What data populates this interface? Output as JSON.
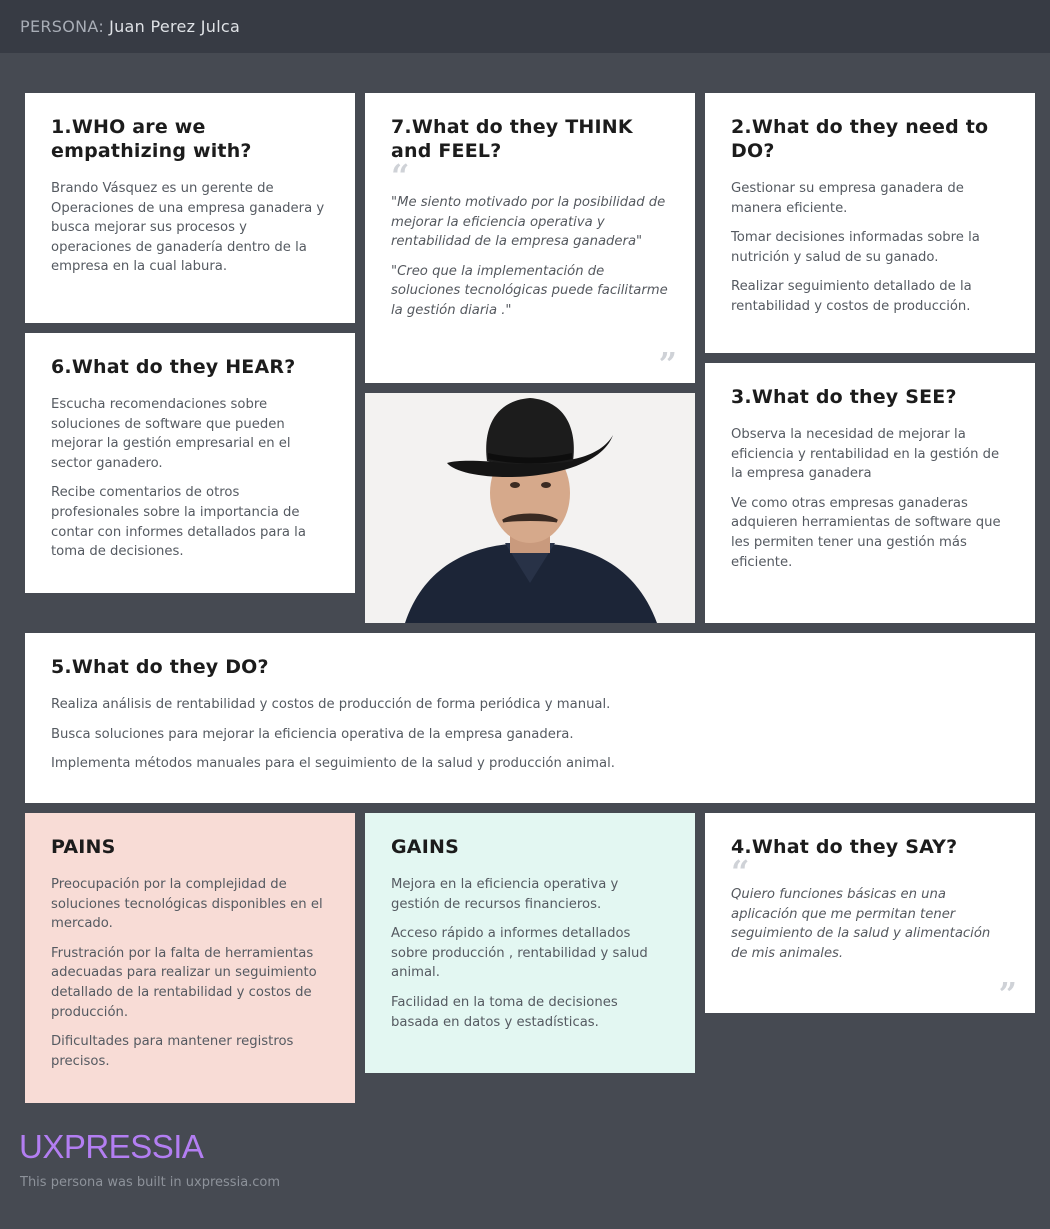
{
  "header": {
    "label": "PERSONA:",
    "name": "Juan Perez Julca"
  },
  "who": {
    "title": "1.WHO are we empathizing with?",
    "items": [
      "Brando Vásquez es un gerente de Operaciones de una empresa ganadera y busca mejorar sus procesos y operaciones de ganadería  dentro de la empresa en la cual labura."
    ]
  },
  "think": {
    "title": "7.What do they THINK and FEEL?",
    "items": [
      "\"Me siento motivado por la posibilidad de mejorar la eficiencia operativa y rentabilidad de la empresa ganadera\"",
      "\"Creo que la implementación de soluciones tecnológicas puede facilitarme la gestión diaria .\""
    ]
  },
  "need": {
    "title": "2.What do they need to DO?",
    "items": [
      "Gestionar su empresa ganadera de manera eficiente.",
      "Tomar decisiones informadas sobre la nutrición y salud de su ganado.",
      "Realizar seguimiento detallado de la rentabilidad y costos de producción."
    ]
  },
  "hear": {
    "title": "6.What do they HEAR?",
    "items": [
      "Escucha recomendaciones sobre soluciones de software que pueden mejorar la gestión empresarial en el sector ganadero.",
      "Recibe comentarios de otros profesionales sobre la importancia de contar con informes detallados para la toma de decisiones."
    ]
  },
  "see": {
    "title": "3.What do they SEE?",
    "items": [
      "Observa la necesidad de mejorar la eficiencia y rentabilidad en la gestión de la empresa ganadera",
      "Ve como otras empresas ganaderas adquieren herramientas de software que les permiten tener una gestión más eficiente."
    ]
  },
  "do": {
    "title": "5.What do they DO?",
    "items": [
      "Realiza análisis de rentabilidad y costos de producción de forma periódica y manual.",
      "Busca soluciones para mejorar la eficiencia operativa de la empresa ganadera.",
      "Implementa métodos manuales para el seguimiento de la salud y producción animal."
    ]
  },
  "pains": {
    "title": "PAINS",
    "items": [
      "Preocupación por la complejidad de soluciones tecnológicas disponibles en el mercado.",
      "Frustración por la falta de herramientas adecuadas para realizar un seguimiento detallado de la rentabilidad y costos de producción.",
      "Dificultades para mantener registros precisos."
    ]
  },
  "gains": {
    "title": "GAINS",
    "items": [
      "Mejora en la eficiencia operativa y gestión de recursos financieros.",
      "Acceso rápido a informes detallados sobre producción , rentabilidad y salud animal.",
      "Facilidad en la toma de decisiones basada en datos y estadísticas."
    ]
  },
  "say": {
    "title": "4.What do they SAY?",
    "items": [
      "Quiero funciones básicas en una aplicación que me permitan tener seguimiento de la salud y alimentación de mis animales."
    ]
  },
  "footer": {
    "logo": "UXPRESSIA",
    "note": "This persona was built in uxpressia.com"
  },
  "colors": {
    "background": "#464a52",
    "topbar": "#373b44",
    "pains": "#f8dcd6",
    "gains": "#e3f7f2",
    "logo": "#b37ef2"
  }
}
